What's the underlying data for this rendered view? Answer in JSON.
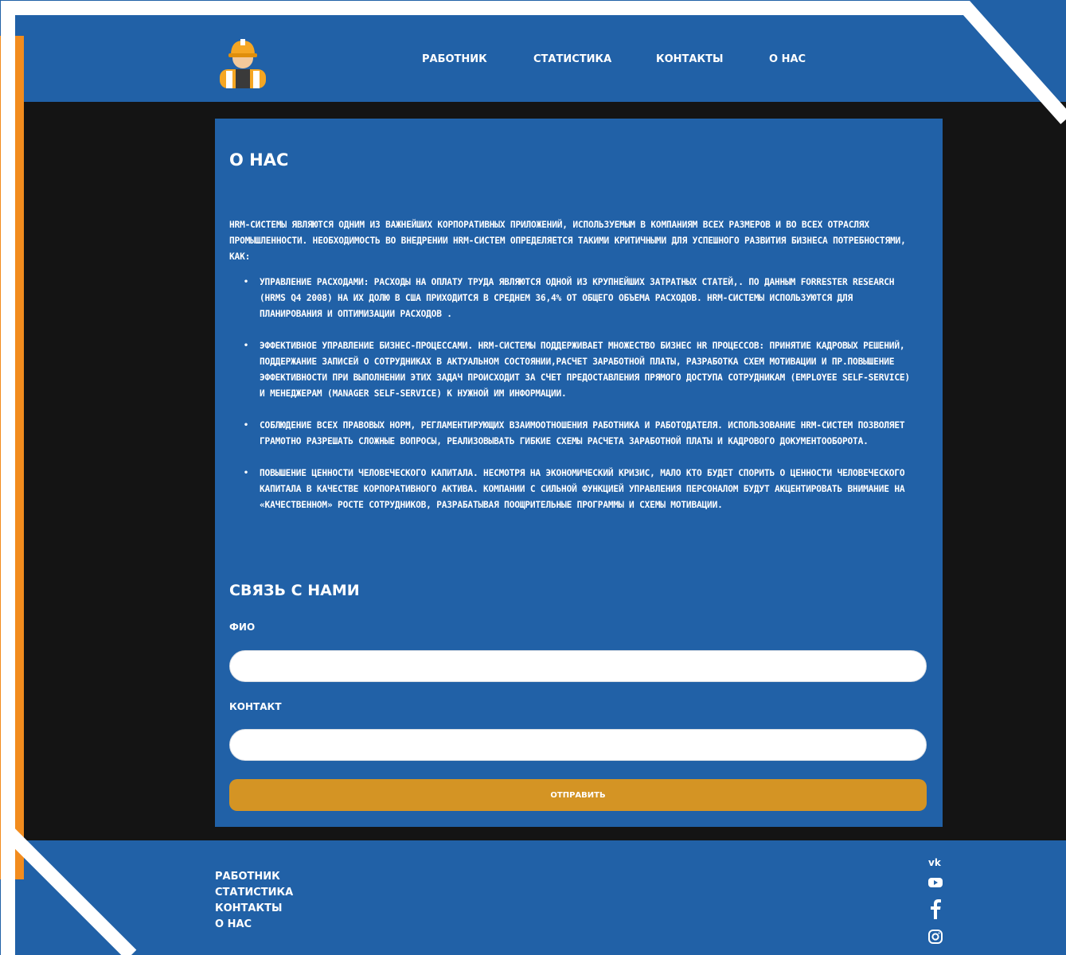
{
  "header": {
    "logo": "construction-worker-icon",
    "nav": [
      "Работник",
      "Статистика",
      "Контакты",
      "О нас"
    ]
  },
  "about": {
    "title": "О нас",
    "intro": "HRM-системы являются одним из важнейших корпоративных приложений, используемым в компаниям всех размеров и во всех отраслях промышленности. Необходимость во внедрении HRM-систем определяется такими критичными для успешного развития бизнеса потребностями, как:",
    "items": [
      {
        "bold": "Управление расходами:",
        "text": " расходы на оплату труда являются одной из крупнейших затратных статей,. По данным Forrester Research (HRMS Q4 2008) на их долю в США приходится в среднем 36,4% от общего объема расходов. HRM-системы используются для планирования и оптимизации расходов ."
      },
      {
        "bold": "Эффективное управление бизнес-процессами.",
        "text": " HRM-системы поддерживает множество бизнес HR процессов: принятие кадровых решений, поддержание записей о сотрудниках в актуальном состоянии,расчет заработной платы, разработка схем мотивации и пр.Повышение эффективности при выполнении этих задач происходит за счет предоставления прямого доступа сотрудникам (Employee Self-Service) и менеджерам (Manager Self-Service) к нужной им информации."
      },
      {
        "bold": "Соблюдение всех правовых норм,",
        "text": " регламентирующих взаимоотношения работника и работодателя. Использование HRM-систем позволяет грамотно разрешать сложные вопросы, реализовывать гибкие схемы расчета заработной платы и кадрового документооборота."
      },
      {
        "bold": "Повышение ценности человеческого капитала.",
        "text": " Несмотря на экономический кризис, мало кто будет спорить о ценности человеческого капитала в качестве корпоративного актива. Компании с сильной функцией управления персоналом будут акцентировать внимание на «качественном» росте сотрудников, разрабатывая поощрительные программы и схемы мотивации."
      }
    ]
  },
  "contact": {
    "title": "Связь с нами",
    "fio_label": "ФИО",
    "fio_value": "",
    "contact_label": "Контакт",
    "contact_value": "",
    "submit_label": "Отправить"
  },
  "footer": {
    "nav": [
      "Работник",
      "Статистика",
      "Контакты",
      "О нас"
    ],
    "social": [
      "vk-icon",
      "youtube-icon",
      "facebook-icon",
      "instagram-icon"
    ]
  },
  "colors": {
    "brand_blue": "#2161a7",
    "accent_orange": "#f28c1e",
    "button_gold": "#d49424",
    "dark_bg": "#141414"
  }
}
